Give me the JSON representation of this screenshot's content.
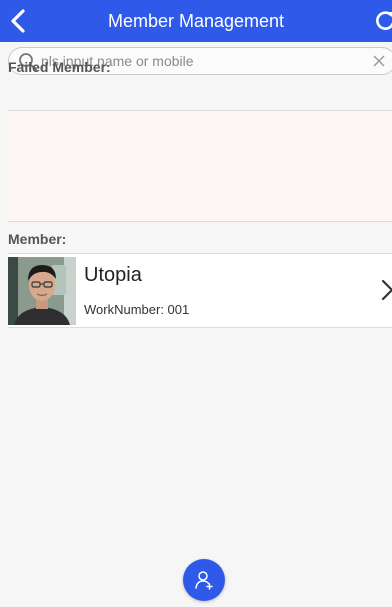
{
  "colors": {
    "header_bg": "#2f59e8",
    "header_text": "#ffffff",
    "page_bg": "#f6f6f6",
    "failed_area_bg": "#fdf6f5",
    "fab_bg": "#2f59e8"
  },
  "header": {
    "title": "Member Management",
    "back_icon": "chevron-left-icon",
    "refresh_icon": "refresh-icon"
  },
  "search": {
    "placeholder": "pls input name or mobile",
    "value": "",
    "search_icon": "search-icon",
    "clear_icon": "close-icon"
  },
  "sections": {
    "failed_label": "Failed Member:",
    "member_label": "Member:"
  },
  "members": [
    {
      "name": "Utopia",
      "work_number": "WorkNumber: 001",
      "avatar_icon": "face-photo",
      "chevron_icon": "chevron-right-icon"
    }
  ],
  "fab": {
    "icon": "add-user-icon"
  }
}
